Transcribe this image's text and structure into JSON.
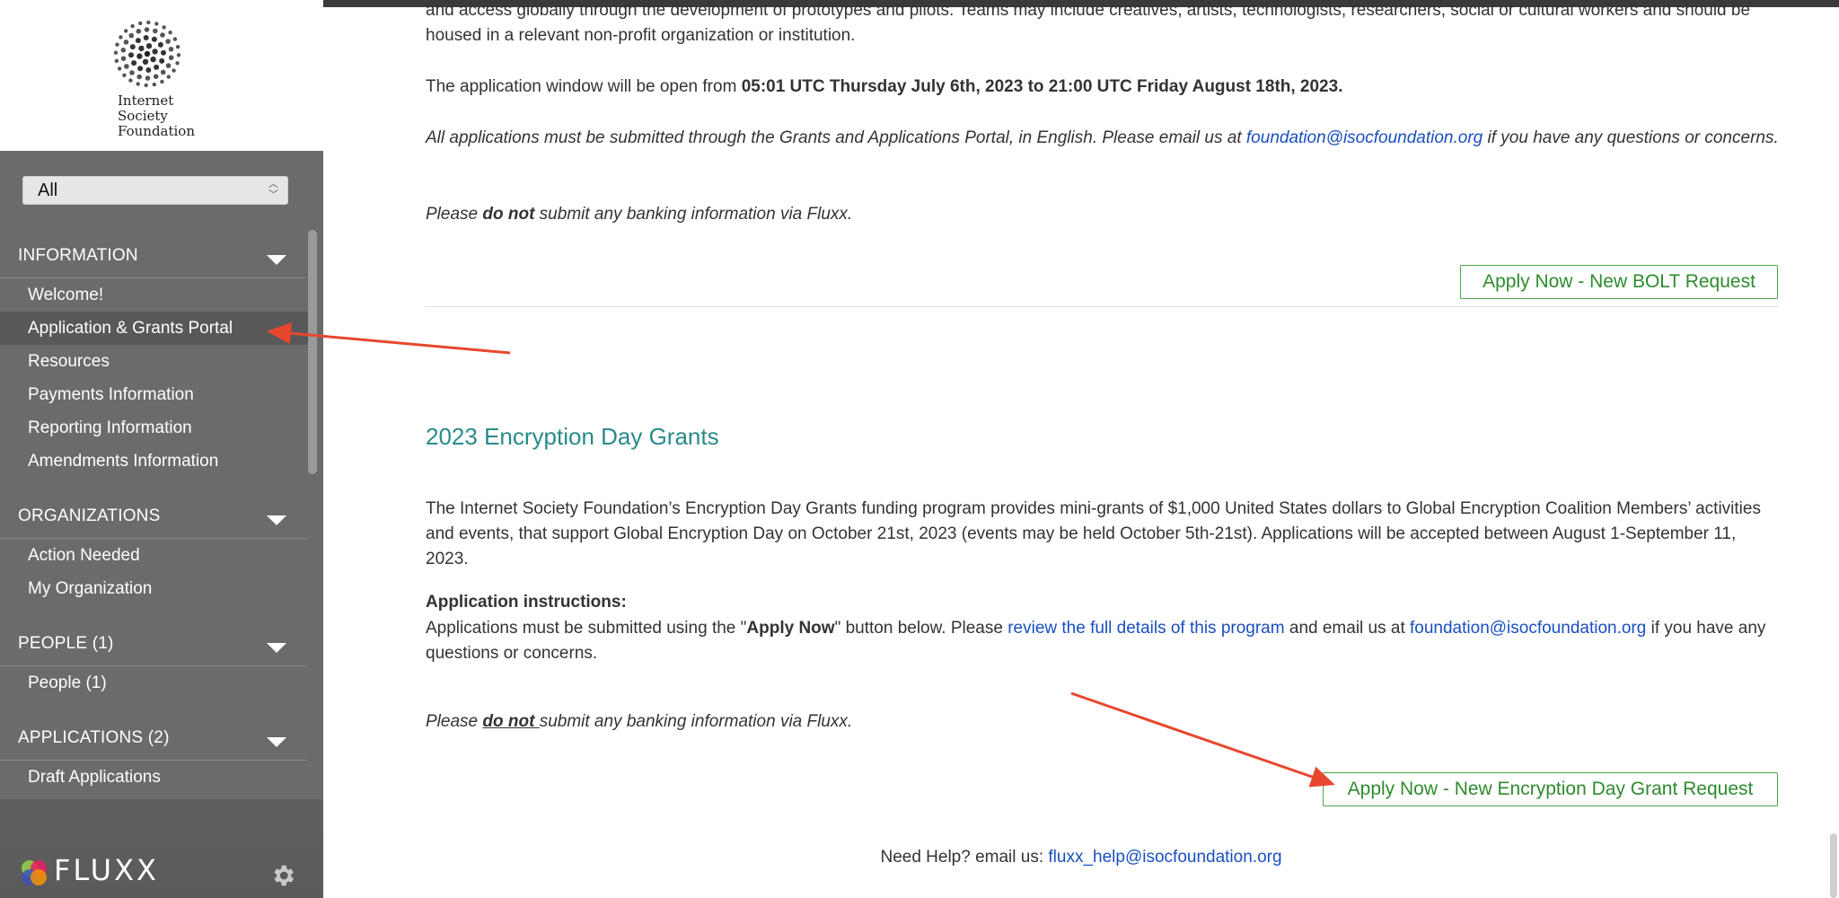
{
  "logo": {
    "line1": "Internet",
    "line2": "Society",
    "line3": "Foundation"
  },
  "sidebar": {
    "filter_value": "All",
    "sections": [
      {
        "title": "INFORMATION",
        "items": [
          "Welcome!",
          "Application & Grants Portal",
          "Resources",
          "Payments Information",
          "Reporting Information",
          "Amendments Information"
        ]
      },
      {
        "title": "ORGANIZATIONS",
        "items": [
          "Action Needed",
          "My Organization"
        ]
      },
      {
        "title": "PEOPLE (1)",
        "items": [
          "People  (1)"
        ]
      },
      {
        "title": "APPLICATIONS (2)",
        "items": [
          "Draft Applications"
        ]
      }
    ],
    "brand": "FLUXX"
  },
  "main": {
    "intro_partial": "and access globally through the development of prototypes and pilots. Teams may include creatives, artists, technologists, researchers, social or cultural workers and should be housed in a relevant non-profit organization or institution.",
    "window_prefix": "The application window will be open from ",
    "window_bold": "05:01 UTC Thursday July 6th, 2023 to 21:00 UTC Friday August 18th, 2023.",
    "portal_text_1": "All applications must be submitted through the Grants and Applications Portal, in English. Please email us at ",
    "portal_email": "foundation@isocfoundation.org",
    "portal_text_2": " if you have any questions or concerns.",
    "banking_1_a": "Please ",
    "banking_1_b": "do not",
    "banking_1_c": " submit any banking information via Fluxx.",
    "bolt_button": "Apply Now - New BOLT Request",
    "section_title": "2023 Encryption Day Grants",
    "enc_desc": "The Internet Society Foundation’s Encryption Day Grants funding program provides mini-grants of $1,000 United States dollars to Global Encryption Coalition Members’ activities and events, that support Global Encryption Day on October 21st, 2023 (events may be held October 5th-21st). Applications will be accepted between August 1-September 11, 2023.",
    "instructions_label": "Application instructions:",
    "instr_1": "Applications must be submitted using the \"",
    "instr_bold": "Apply Now",
    "instr_2": "\" button below. Please ",
    "instr_link": "review the full details of this program",
    "instr_3": " and email us at ",
    "instr_email": "foundation@isocfoundation.org",
    "instr_4": " if you have any questions or concerns.",
    "banking_2_a": "Please ",
    "banking_2_b": "do not ",
    "banking_2_c": "submit any banking information via Fluxx.",
    "enc_button": "Apply Now - New Encryption Day Grant Request",
    "help_prefix": "Need Help? email us: ",
    "help_email": "fluxx_help@isocfoundation.org"
  },
  "colors": {
    "sidebar": "#6b6b6b",
    "button_green": "#2e8b2e",
    "title_teal": "#2a8a8a",
    "link_blue": "#1a4fbf",
    "annotation_red": "#e8472e"
  },
  "icons": [
    "internet-society-logo-icon",
    "caret-down-icon",
    "fluxx-logo-icon",
    "gear-icon",
    "annotation-arrow-icon"
  ]
}
